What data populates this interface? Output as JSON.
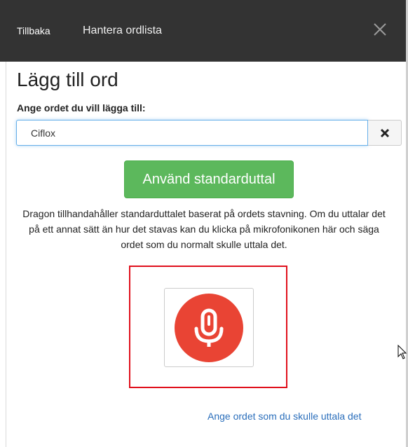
{
  "header": {
    "back_label": "Tillbaka",
    "manage_label": "Hantera ordlista",
    "close_icon": "close-icon"
  },
  "main": {
    "title": "Lägg till ord",
    "field_label": "Ange ordet du vill lägga till:",
    "word_value": "Ciflox",
    "clear_icon": "times-icon",
    "default_button_label": "Använd standarduttal",
    "help_text": "Dragon tillhandahåller standarduttalet baserat på ordets stavning. Om du uttalar det på ett annat sätt än hur det stavas kan du klicka på mikrofonikonen här och säga ordet som du normalt skulle uttala det.",
    "mic_icon": "microphone-icon",
    "speak_link": "Ange ordet som du skulle uttala det"
  },
  "colors": {
    "topbar": "#333333",
    "accent_green": "#5cb85c",
    "mic_red": "#e94434",
    "highlight_red": "#e0101c",
    "link_blue": "#2a6ebb"
  }
}
